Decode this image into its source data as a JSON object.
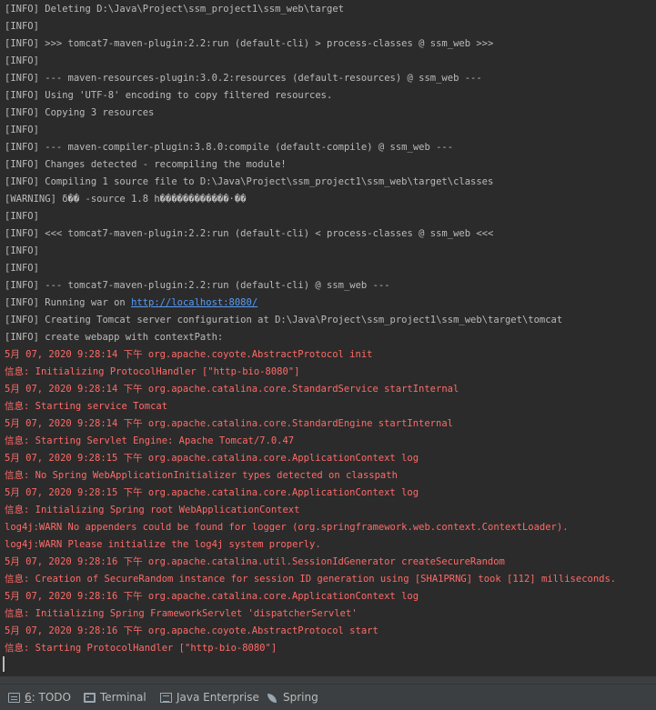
{
  "console": {
    "lines": [
      {
        "text": "[INFO] Deleting D:\\Java\\Project\\ssm_project1\\ssm_web\\target",
        "level": "info"
      },
      {
        "text": "[INFO]",
        "level": "info"
      },
      {
        "text": "[INFO] >>> tomcat7-maven-plugin:2.2:run (default-cli) > process-classes @ ssm_web >>>",
        "level": "info"
      },
      {
        "text": "[INFO]",
        "level": "info"
      },
      {
        "text": "[INFO] --- maven-resources-plugin:3.0.2:resources (default-resources) @ ssm_web ---",
        "level": "info"
      },
      {
        "text": "[INFO] Using 'UTF-8' encoding to copy filtered resources.",
        "level": "info"
      },
      {
        "text": "[INFO] Copying 3 resources",
        "level": "info"
      },
      {
        "text": "[INFO]",
        "level": "info"
      },
      {
        "text": "[INFO] --- maven-compiler-plugin:3.8.0:compile (default-compile) @ ssm_web ---",
        "level": "info"
      },
      {
        "text": "[INFO] Changes detected - recompiling the module!",
        "level": "info"
      },
      {
        "text": "[INFO] Compiling 1 source file to D:\\Java\\Project\\ssm_project1\\ssm_web\\target\\classes",
        "level": "info"
      },
      {
        "text": "[WARNING] δ�� -source 1.8 h������������·��",
        "level": "info"
      },
      {
        "text": "[INFO]",
        "level": "info"
      },
      {
        "text": "[INFO] <<< tomcat7-maven-plugin:2.2:run (default-cli) < process-classes @ ssm_web <<<",
        "level": "info"
      },
      {
        "text": "[INFO]",
        "level": "info"
      },
      {
        "text": "[INFO]",
        "level": "info"
      },
      {
        "text": "[INFO] --- tomcat7-maven-plugin:2.2:run (default-cli) @ ssm_web ---",
        "level": "info"
      },
      {
        "text": "[INFO] Running war on ",
        "level": "info",
        "link": "http://localhost:8080/"
      },
      {
        "text": "[INFO] Creating Tomcat server configuration at D:\\Java\\Project\\ssm_project1\\ssm_web\\target\\tomcat",
        "level": "info"
      },
      {
        "text": "[INFO] create webapp with contextPath:",
        "level": "info"
      },
      {
        "text": "5月 07, 2020 9:28:14 下午 org.apache.coyote.AbstractProtocol init",
        "level": "err"
      },
      {
        "text": "信息: Initializing ProtocolHandler [\"http-bio-8080\"]",
        "level": "err"
      },
      {
        "text": "5月 07, 2020 9:28:14 下午 org.apache.catalina.core.StandardService startInternal",
        "level": "err"
      },
      {
        "text": "信息: Starting service Tomcat",
        "level": "err"
      },
      {
        "text": "5月 07, 2020 9:28:14 下午 org.apache.catalina.core.StandardEngine startInternal",
        "level": "err"
      },
      {
        "text": "信息: Starting Servlet Engine: Apache Tomcat/7.0.47",
        "level": "err"
      },
      {
        "text": "5月 07, 2020 9:28:15 下午 org.apache.catalina.core.ApplicationContext log",
        "level": "err"
      },
      {
        "text": "信息: No Spring WebApplicationInitializer types detected on classpath",
        "level": "err"
      },
      {
        "text": "5月 07, 2020 9:28:15 下午 org.apache.catalina.core.ApplicationContext log",
        "level": "err"
      },
      {
        "text": "信息: Initializing Spring root WebApplicationContext",
        "level": "err"
      },
      {
        "text": "log4j:WARN No appenders could be found for logger (org.springframework.web.context.ContextLoader).",
        "level": "err"
      },
      {
        "text": "log4j:WARN Please initialize the log4j system properly.",
        "level": "err"
      },
      {
        "text": "5月 07, 2020 9:28:16 下午 org.apache.catalina.util.SessionIdGenerator createSecureRandom",
        "level": "err"
      },
      {
        "text": "信息: Creation of SecureRandom instance for session ID generation using [SHA1PRNG] took [112] milliseconds.",
        "level": "err"
      },
      {
        "text": "5月 07, 2020 9:28:16 下午 org.apache.catalina.core.ApplicationContext log",
        "level": "err"
      },
      {
        "text": "信息: Initializing Spring FrameworkServlet 'dispatcherServlet'",
        "level": "err"
      },
      {
        "text": "5月 07, 2020 9:28:16 下午 org.apache.coyote.AbstractProtocol start",
        "level": "err"
      },
      {
        "text": "信息: Starting ProtocolHandler [\"http-bio-8080\"]",
        "level": "err"
      }
    ]
  },
  "toolbar": {
    "todo_mnemonic": "6",
    "todo_label": ": TODO",
    "terminal_label": "Terminal",
    "java_enterprise_label": "Java Enterprise",
    "spring_label": "Spring"
  },
  "colors": {
    "background": "#2b2b2b",
    "info_text": "#bbbbbb",
    "error_text": "#ff6b68",
    "link": "#589df6",
    "toolbar": "#3c3f41"
  }
}
